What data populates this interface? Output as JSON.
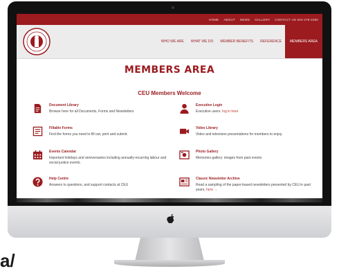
{
  "topbar": {
    "links": [
      "HOME",
      "ABOUT",
      "NEWS",
      "GALLERY"
    ],
    "contact": "CONTACT US 604-278-4050"
  },
  "nav": {
    "items": [
      "WHO WE ARE",
      "WHAT WE DO",
      "MEMBER BENEFITS",
      "REFERENCE"
    ],
    "active": "MEMBERS AREA"
  },
  "page": {
    "title": "MEMBERS AREA",
    "welcome": "CEU Members Welcome"
  },
  "items": {
    "documents": {
      "icon": "document-icon",
      "title": "Document Library",
      "desc": "Browse here for all Documents, Forms and Newsletters"
    },
    "executive": {
      "icon": "person-icon",
      "title": "Executive Login",
      "desc": "Executive users:",
      "link": "log in here"
    },
    "forms": {
      "icon": "form-icon",
      "title": "Fillable Forms",
      "desc": "Find the forms you need to fill out, print and submit."
    },
    "video": {
      "icon": "video-camera-icon",
      "title": "Video Library",
      "desc": "Video and television presentations for members to enjoy."
    },
    "calendar": {
      "icon": "calendar-icon",
      "title": "Events Calendar",
      "desc": "Important holidays and anniversaries including annually-recurring labour and social justice events."
    },
    "photo": {
      "icon": "photo-icon",
      "title": "Photo Gallery",
      "desc": "Memories gallery: images from past events"
    },
    "help": {
      "icon": "question-icon",
      "title": "Help Centre",
      "desc": "Answers to questions, and support contacts at CEU"
    },
    "newsletter": {
      "icon": "newspaper-icon",
      "title": "Classic Newsletter Archive",
      "desc": "Read a sampling of the paper-based newsletters presented by CEU in past years,",
      "link": "here →"
    }
  },
  "stray_text": "a/",
  "colors": {
    "brand": "#9b1b1f",
    "header_bg": "#ececec"
  }
}
